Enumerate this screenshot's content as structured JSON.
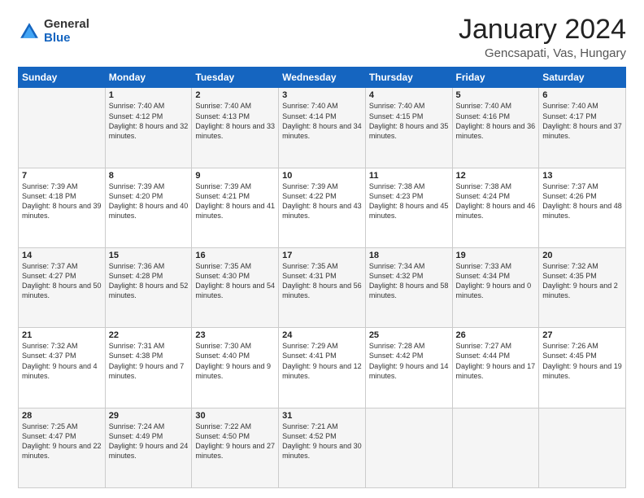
{
  "logo": {
    "general": "General",
    "blue": "Blue"
  },
  "title": "January 2024",
  "subtitle": "Gencsapati, Vas, Hungary",
  "header_days": [
    "Sunday",
    "Monday",
    "Tuesday",
    "Wednesday",
    "Thursday",
    "Friday",
    "Saturday"
  ],
  "weeks": [
    [
      {
        "day": "",
        "sunrise": "",
        "sunset": "",
        "daylight": ""
      },
      {
        "day": "1",
        "sunrise": "Sunrise: 7:40 AM",
        "sunset": "Sunset: 4:12 PM",
        "daylight": "Daylight: 8 hours and 32 minutes."
      },
      {
        "day": "2",
        "sunrise": "Sunrise: 7:40 AM",
        "sunset": "Sunset: 4:13 PM",
        "daylight": "Daylight: 8 hours and 33 minutes."
      },
      {
        "day": "3",
        "sunrise": "Sunrise: 7:40 AM",
        "sunset": "Sunset: 4:14 PM",
        "daylight": "Daylight: 8 hours and 34 minutes."
      },
      {
        "day": "4",
        "sunrise": "Sunrise: 7:40 AM",
        "sunset": "Sunset: 4:15 PM",
        "daylight": "Daylight: 8 hours and 35 minutes."
      },
      {
        "day": "5",
        "sunrise": "Sunrise: 7:40 AM",
        "sunset": "Sunset: 4:16 PM",
        "daylight": "Daylight: 8 hours and 36 minutes."
      },
      {
        "day": "6",
        "sunrise": "Sunrise: 7:40 AM",
        "sunset": "Sunset: 4:17 PM",
        "daylight": "Daylight: 8 hours and 37 minutes."
      }
    ],
    [
      {
        "day": "7",
        "sunrise": "Sunrise: 7:39 AM",
        "sunset": "Sunset: 4:18 PM",
        "daylight": "Daylight: 8 hours and 39 minutes."
      },
      {
        "day": "8",
        "sunrise": "Sunrise: 7:39 AM",
        "sunset": "Sunset: 4:20 PM",
        "daylight": "Daylight: 8 hours and 40 minutes."
      },
      {
        "day": "9",
        "sunrise": "Sunrise: 7:39 AM",
        "sunset": "Sunset: 4:21 PM",
        "daylight": "Daylight: 8 hours and 41 minutes."
      },
      {
        "day": "10",
        "sunrise": "Sunrise: 7:39 AM",
        "sunset": "Sunset: 4:22 PM",
        "daylight": "Daylight: 8 hours and 43 minutes."
      },
      {
        "day": "11",
        "sunrise": "Sunrise: 7:38 AM",
        "sunset": "Sunset: 4:23 PM",
        "daylight": "Daylight: 8 hours and 45 minutes."
      },
      {
        "day": "12",
        "sunrise": "Sunrise: 7:38 AM",
        "sunset": "Sunset: 4:24 PM",
        "daylight": "Daylight: 8 hours and 46 minutes."
      },
      {
        "day": "13",
        "sunrise": "Sunrise: 7:37 AM",
        "sunset": "Sunset: 4:26 PM",
        "daylight": "Daylight: 8 hours and 48 minutes."
      }
    ],
    [
      {
        "day": "14",
        "sunrise": "Sunrise: 7:37 AM",
        "sunset": "Sunset: 4:27 PM",
        "daylight": "Daylight: 8 hours and 50 minutes."
      },
      {
        "day": "15",
        "sunrise": "Sunrise: 7:36 AM",
        "sunset": "Sunset: 4:28 PM",
        "daylight": "Daylight: 8 hours and 52 minutes."
      },
      {
        "day": "16",
        "sunrise": "Sunrise: 7:35 AM",
        "sunset": "Sunset: 4:30 PM",
        "daylight": "Daylight: 8 hours and 54 minutes."
      },
      {
        "day": "17",
        "sunrise": "Sunrise: 7:35 AM",
        "sunset": "Sunset: 4:31 PM",
        "daylight": "Daylight: 8 hours and 56 minutes."
      },
      {
        "day": "18",
        "sunrise": "Sunrise: 7:34 AM",
        "sunset": "Sunset: 4:32 PM",
        "daylight": "Daylight: 8 hours and 58 minutes."
      },
      {
        "day": "19",
        "sunrise": "Sunrise: 7:33 AM",
        "sunset": "Sunset: 4:34 PM",
        "daylight": "Daylight: 9 hours and 0 minutes."
      },
      {
        "day": "20",
        "sunrise": "Sunrise: 7:32 AM",
        "sunset": "Sunset: 4:35 PM",
        "daylight": "Daylight: 9 hours and 2 minutes."
      }
    ],
    [
      {
        "day": "21",
        "sunrise": "Sunrise: 7:32 AM",
        "sunset": "Sunset: 4:37 PM",
        "daylight": "Daylight: 9 hours and 4 minutes."
      },
      {
        "day": "22",
        "sunrise": "Sunrise: 7:31 AM",
        "sunset": "Sunset: 4:38 PM",
        "daylight": "Daylight: 9 hours and 7 minutes."
      },
      {
        "day": "23",
        "sunrise": "Sunrise: 7:30 AM",
        "sunset": "Sunset: 4:40 PM",
        "daylight": "Daylight: 9 hours and 9 minutes."
      },
      {
        "day": "24",
        "sunrise": "Sunrise: 7:29 AM",
        "sunset": "Sunset: 4:41 PM",
        "daylight": "Daylight: 9 hours and 12 minutes."
      },
      {
        "day": "25",
        "sunrise": "Sunrise: 7:28 AM",
        "sunset": "Sunset: 4:42 PM",
        "daylight": "Daylight: 9 hours and 14 minutes."
      },
      {
        "day": "26",
        "sunrise": "Sunrise: 7:27 AM",
        "sunset": "Sunset: 4:44 PM",
        "daylight": "Daylight: 9 hours and 17 minutes."
      },
      {
        "day": "27",
        "sunrise": "Sunrise: 7:26 AM",
        "sunset": "Sunset: 4:45 PM",
        "daylight": "Daylight: 9 hours and 19 minutes."
      }
    ],
    [
      {
        "day": "28",
        "sunrise": "Sunrise: 7:25 AM",
        "sunset": "Sunset: 4:47 PM",
        "daylight": "Daylight: 9 hours and 22 minutes."
      },
      {
        "day": "29",
        "sunrise": "Sunrise: 7:24 AM",
        "sunset": "Sunset: 4:49 PM",
        "daylight": "Daylight: 9 hours and 24 minutes."
      },
      {
        "day": "30",
        "sunrise": "Sunrise: 7:22 AM",
        "sunset": "Sunset: 4:50 PM",
        "daylight": "Daylight: 9 hours and 27 minutes."
      },
      {
        "day": "31",
        "sunrise": "Sunrise: 7:21 AM",
        "sunset": "Sunset: 4:52 PM",
        "daylight": "Daylight: 9 hours and 30 minutes."
      },
      {
        "day": "",
        "sunrise": "",
        "sunset": "",
        "daylight": ""
      },
      {
        "day": "",
        "sunrise": "",
        "sunset": "",
        "daylight": ""
      },
      {
        "day": "",
        "sunrise": "",
        "sunset": "",
        "daylight": ""
      }
    ]
  ]
}
